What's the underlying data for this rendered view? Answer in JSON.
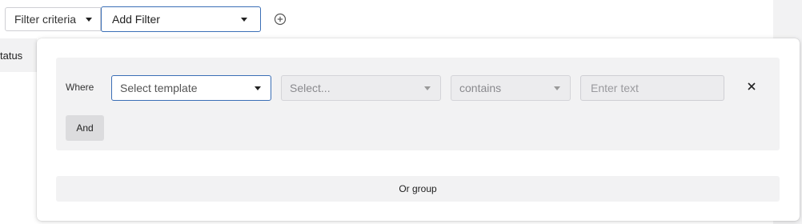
{
  "toolbar": {
    "filter_criteria_label": "Filter criteria",
    "add_filter_label": "Add Filter"
  },
  "background": {
    "status_text": "tatus"
  },
  "filter_panel": {
    "where_label": "Where",
    "template_select_value": "Select template",
    "field_select_value": "Select...",
    "operator_select_value": "contains",
    "text_input_placeholder": "Enter text",
    "and_label": "And",
    "or_group_label": "Or group"
  },
  "colors": {
    "accent_border": "#3b6fb6",
    "panel_grey": "#f2f2f3",
    "and_button_bg": "#dcdcde"
  }
}
